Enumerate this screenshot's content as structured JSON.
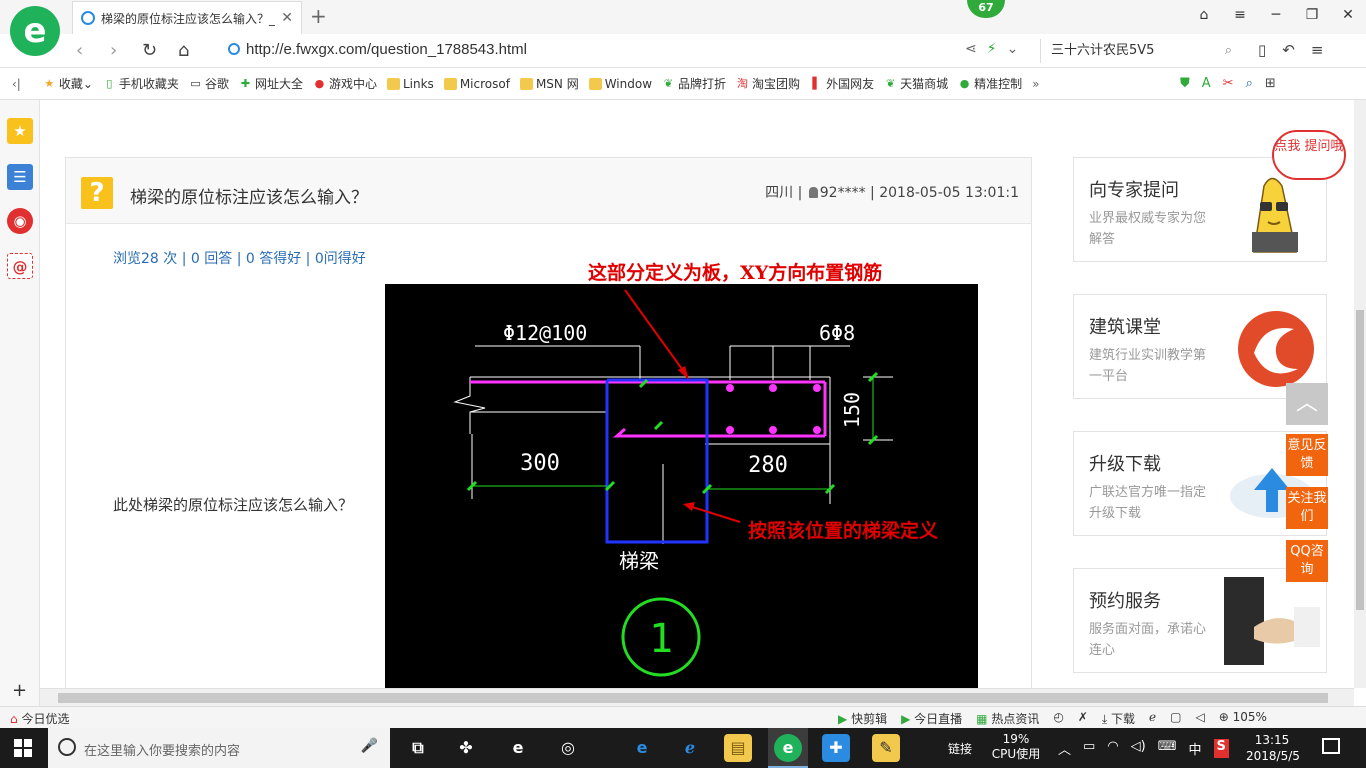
{
  "browser": {
    "tab_title": "梯梁的原位标注应该怎么输入？_",
    "badge_count": "67",
    "url": "http://e.fwxgx.com/question_1788543.html",
    "search_query": "三十六计农民5V5",
    "zoom": "105%"
  },
  "bookmarks": [
    {
      "label": "收藏",
      "icon": "star-icon"
    },
    {
      "label": "手机收藏夹",
      "icon": "phone-icon"
    },
    {
      "label": "谷歌",
      "icon": "page-icon"
    },
    {
      "label": "网址大全",
      "icon": "plus-icon"
    },
    {
      "label": "游戏中心",
      "icon": "game-icon"
    },
    {
      "label": "Links",
      "icon": "folder-icon"
    },
    {
      "label": "Microsof",
      "icon": "folder-icon"
    },
    {
      "label": "MSN 网",
      "icon": "folder-icon"
    },
    {
      "label": "Window",
      "icon": "folder-icon"
    },
    {
      "label": "品牌打折",
      "icon": "leaf-icon"
    },
    {
      "label": "淘宝团购",
      "icon": "taobao-icon"
    },
    {
      "label": "外国网友",
      "icon": "flag-icon"
    },
    {
      "label": "天猫商城",
      "icon": "leaf-icon"
    },
    {
      "label": "精准控制",
      "icon": "chat-icon"
    }
  ],
  "question": {
    "title": "梯梁的原位标注应该怎么输入？",
    "location": "四川",
    "user": "92****",
    "datetime": "2018-05-05 13:01:1",
    "stats": "浏览28 次 | 0 回答 | 0 答得好 | 0问得好",
    "body": "此处梯梁的原位标注应该怎么输入？"
  },
  "figure": {
    "annotation_top": "这部分定义为板，XY方向布置钢筋",
    "annotation_bottom": "按照该位置的梯梁定义",
    "rebar_label_left": "Φ12@100",
    "rebar_label_right": "6Φ8",
    "dim_300": "300",
    "dim_280": "280",
    "dim_150": "150",
    "beam_label": "梯梁",
    "section_no": "1"
  },
  "sidebar": {
    "cards": [
      {
        "title": "向专家提问",
        "desc": "业界最权威专家为您解答",
        "bubble": "点我 提问哦"
      },
      {
        "title": "建筑课堂",
        "desc": "建筑行业实训教学第一平台"
      },
      {
        "title": "升级下载",
        "desc": "广联达官方唯一指定升级下载"
      },
      {
        "title": "预约服务",
        "desc": "服务面对面，承诺心连心"
      }
    ],
    "float_buttons": [
      "意见反馈",
      "关注我们",
      "QQ咨询"
    ]
  },
  "statusbar": {
    "left": "今日优选",
    "items": [
      "快剪辑",
      "今日直播",
      "热点资讯",
      "下载"
    ]
  },
  "taskbar": {
    "search_placeholder": "在这里输入你要搜索的内容",
    "link_label": "链接",
    "cpu_percent": "19%",
    "cpu_label": "CPU使用",
    "ime": "中",
    "time": "13:15",
    "date": "2018/5/5"
  },
  "colors": {
    "accent_green": "#1fb25a",
    "link_blue": "#2a6db5",
    "orange": "#f2650f",
    "annotation_red": "#e00000",
    "cad_magenta": "#ff33ff",
    "cad_blue": "#2233ff",
    "cad_green": "#22dd22"
  }
}
